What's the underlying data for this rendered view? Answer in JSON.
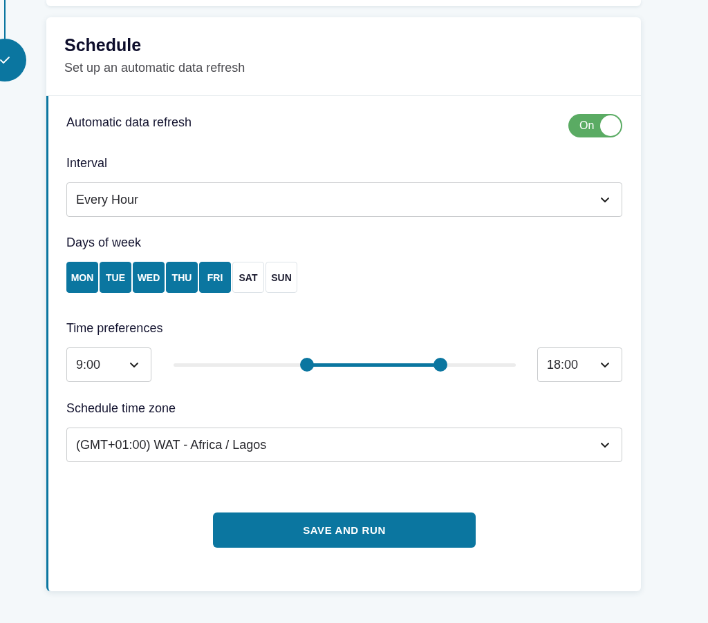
{
  "card": {
    "title": "Schedule",
    "subtitle": "Set up an automatic data refresh"
  },
  "auto_refresh": {
    "label": "Automatic data refresh",
    "toggle_label": "On",
    "on": true
  },
  "interval": {
    "label": "Interval",
    "value": "Every Hour"
  },
  "days": {
    "label": "Days of week",
    "items": [
      {
        "label": "MON",
        "selected": true
      },
      {
        "label": "TUE",
        "selected": true
      },
      {
        "label": "WED",
        "selected": true
      },
      {
        "label": "THU",
        "selected": true
      },
      {
        "label": "FRI",
        "selected": true
      },
      {
        "label": "SAT",
        "selected": false
      },
      {
        "label": "SUN",
        "selected": false
      }
    ]
  },
  "time_preferences": {
    "label": "Time preferences",
    "start": "9:00",
    "end": "18:00",
    "range": [
      {
        "level": 0.39
      },
      {
        "level": 0.78
      }
    ]
  },
  "time_zone": {
    "label": "Schedule time zone",
    "value": "(GMT+01:00) WAT - Africa / Lagos"
  },
  "submit": {
    "label": "SAVE AND RUN"
  }
}
